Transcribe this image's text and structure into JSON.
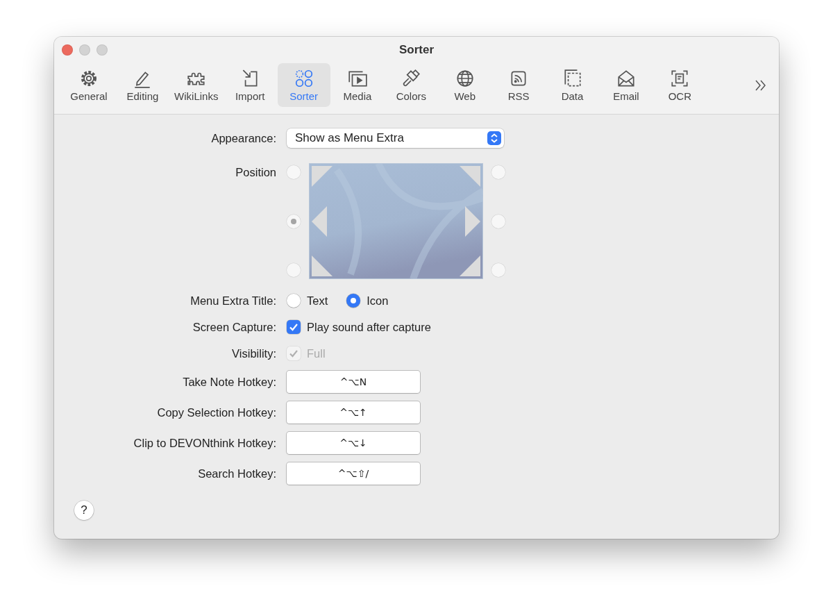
{
  "window": {
    "title": "Sorter"
  },
  "toolbar": {
    "tabs": [
      {
        "label": "General",
        "selected": false
      },
      {
        "label": "Editing",
        "selected": false
      },
      {
        "label": "WikiLinks",
        "selected": false
      },
      {
        "label": "Import",
        "selected": false
      },
      {
        "label": "Sorter",
        "selected": true
      },
      {
        "label": "Media",
        "selected": false
      },
      {
        "label": "Colors",
        "selected": false
      },
      {
        "label": "Web",
        "selected": false
      },
      {
        "label": "RSS",
        "selected": false
      },
      {
        "label": "Data",
        "selected": false
      },
      {
        "label": "Email",
        "selected": false
      },
      {
        "label": "OCR",
        "selected": false
      }
    ]
  },
  "form": {
    "rows": [
      {
        "kind": "popup",
        "label": "Appearance:",
        "value": "Show as Menu Extra"
      },
      {
        "kind": "position",
        "label": "Position",
        "disabled": true,
        "options": [
          {
            "selected": false
          },
          {
            "selected": false
          },
          {
            "selected": true
          },
          {
            "selected": false
          },
          {
            "selected": false
          },
          {
            "selected": false
          }
        ]
      },
      {
        "kind": "radio",
        "label": "Menu Extra Title:",
        "options": [
          {
            "label": "Text",
            "selected": false
          },
          {
            "label": "Icon",
            "selected": true
          }
        ]
      },
      {
        "kind": "checkbox",
        "label": "Screen Capture:",
        "text": "Play sound after capture",
        "checked": true,
        "disabled": false
      },
      {
        "kind": "checkbox",
        "label": "Visibility:",
        "text": "Full",
        "checked": true,
        "disabled": true
      },
      {
        "kind": "hotkey",
        "label": "Take Note Hotkey:",
        "value": "^⌥N"
      },
      {
        "kind": "hotkey",
        "label": "Copy Selection Hotkey:",
        "value": "^⌥↑"
      },
      {
        "kind": "hotkey",
        "label": "Clip to DEVONthink Hotkey:",
        "value": "^⌥↓"
      },
      {
        "kind": "hotkey",
        "label": "Search Hotkey:",
        "value": "^⌥⇧/"
      }
    ]
  },
  "help": "?"
}
